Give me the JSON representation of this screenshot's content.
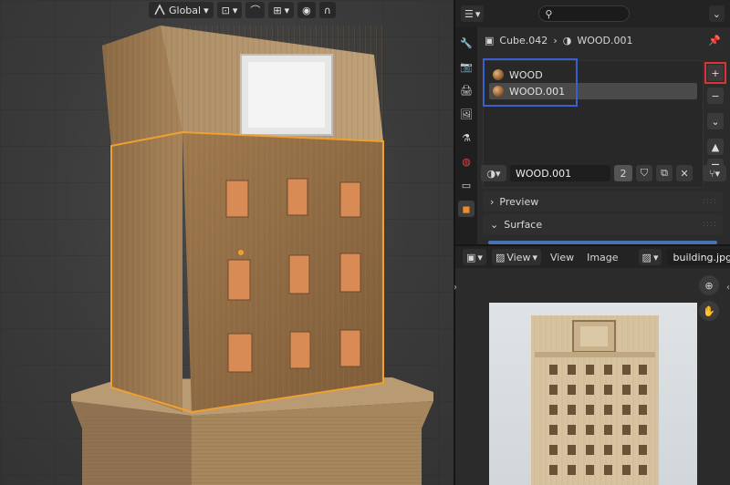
{
  "viewport": {
    "transform_orientation": "Global"
  },
  "properties": {
    "breadcrumb": {
      "object": "Cube.042",
      "material": "WOOD.001"
    },
    "material_slots": [
      {
        "label": "WOOD",
        "active": false
      },
      {
        "label": "WOOD.001",
        "active": true
      }
    ],
    "material_name": "WOOD.001",
    "user_count": "2",
    "sections": {
      "preview": "Preview",
      "surface": "Surface"
    }
  },
  "image_editor": {
    "view_menu": "View",
    "menus": [
      "View",
      "Image"
    ],
    "image_name": "building.jpg"
  },
  "colors": {
    "highlight_blue": "#3a5fd0",
    "highlight_red": "#dd3333",
    "selection_orange": "#f0a030"
  }
}
